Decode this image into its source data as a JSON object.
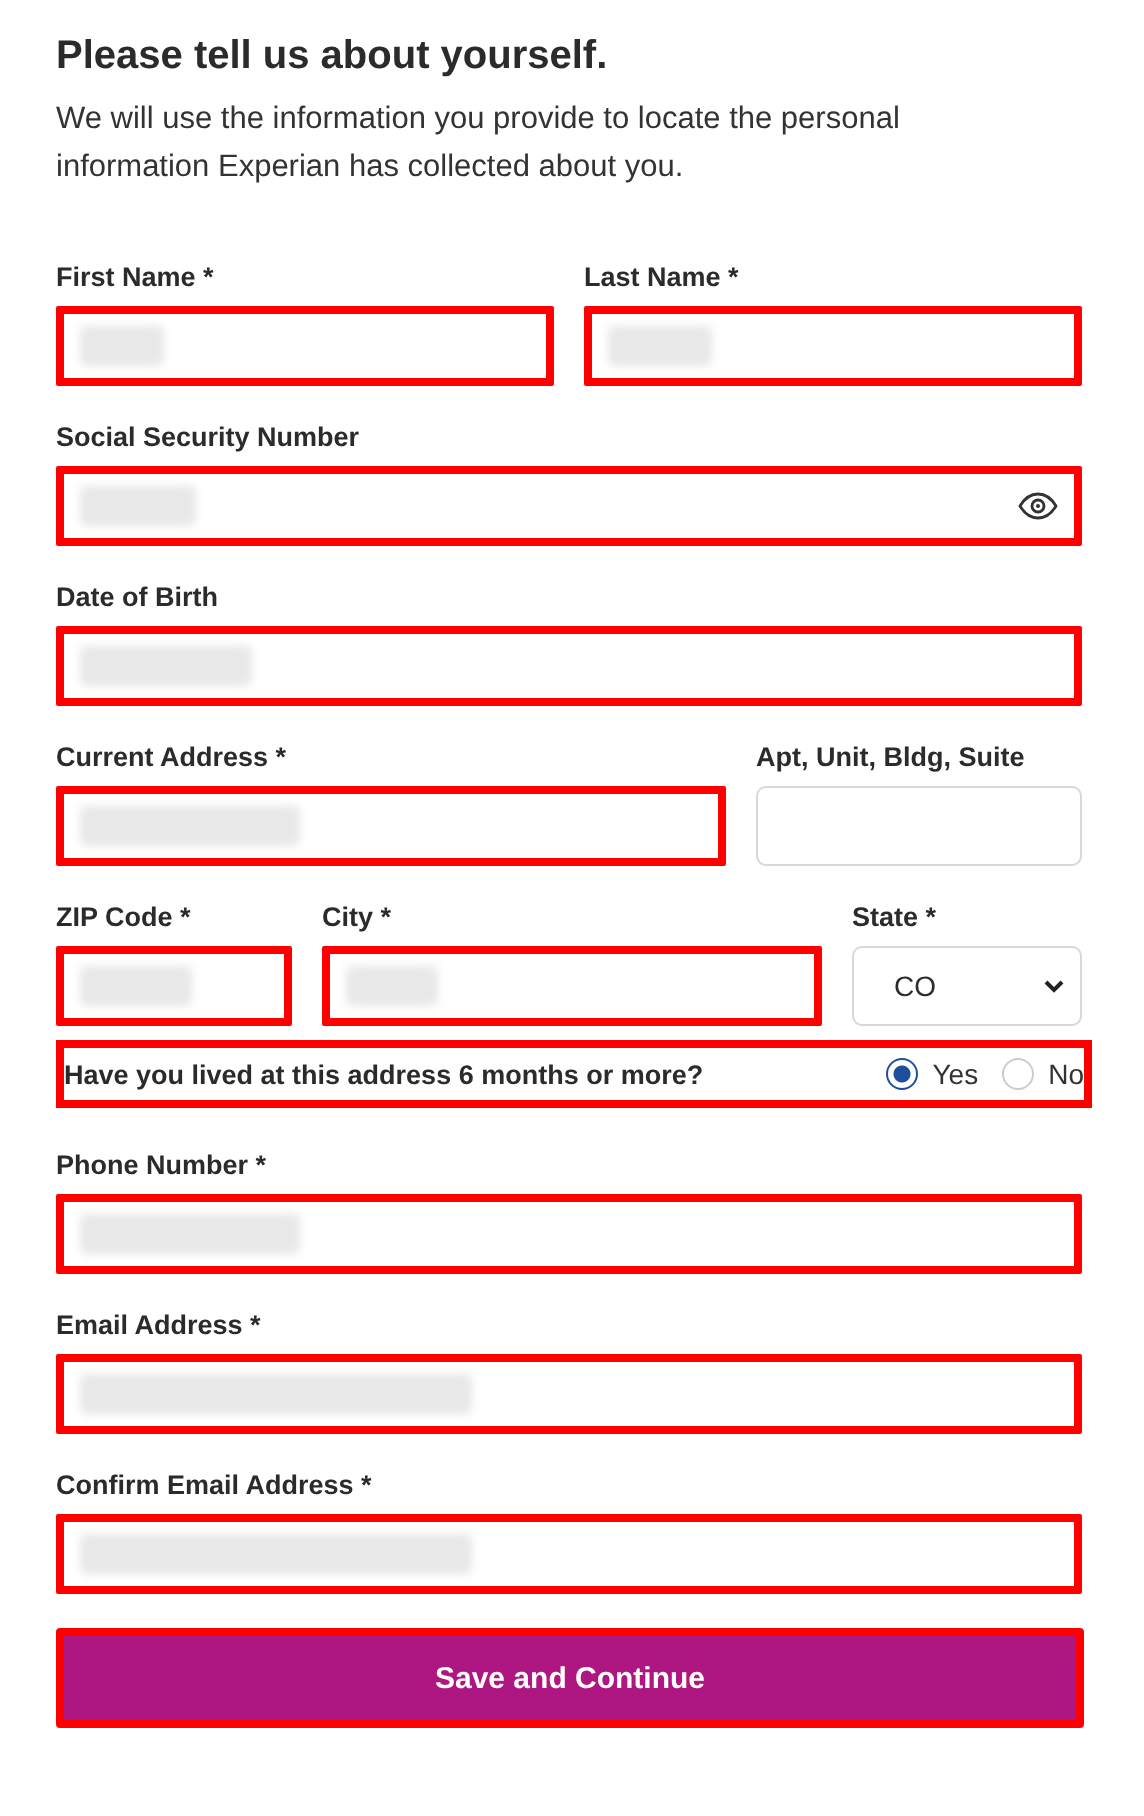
{
  "heading": "Please tell us about yourself.",
  "intro": "We will use the information you provide to locate the personal information Experian has collected about you.",
  "rows": [
    {
      "kind": "fields",
      "fields": [
        {
          "label": "First Name *",
          "kind": "text",
          "blurred": true,
          "highlighted": true
        },
        {
          "label": "Last Name *",
          "kind": "text",
          "blurred": true,
          "highlighted": true
        }
      ]
    },
    {
      "kind": "fields",
      "fields": [
        {
          "label": "Social Security Number",
          "kind": "password",
          "blurred": true,
          "highlighted": true
        }
      ]
    },
    {
      "kind": "fields",
      "fields": [
        {
          "label": "Date of Birth",
          "kind": "text",
          "blurred": true,
          "highlighted": true
        }
      ]
    },
    {
      "kind": "fields",
      "fields": [
        {
          "label": "Current Address *",
          "kind": "text",
          "blurred": true,
          "highlighted": true
        },
        {
          "label": "Apt, Unit, Bldg, Suite",
          "kind": "text",
          "blurred": false,
          "highlighted": false
        }
      ]
    },
    {
      "kind": "fields",
      "fields": [
        {
          "label": "ZIP Code *",
          "kind": "text",
          "blurred": true,
          "highlighted": true
        },
        {
          "label": "City *",
          "kind": "text",
          "blurred": true,
          "highlighted": true
        },
        {
          "label": "State *",
          "kind": "select",
          "value": "CO",
          "highlighted": false
        }
      ]
    },
    {
      "kind": "question",
      "text": "Have you lived at this address 6 months or more?",
      "highlighted": true,
      "options": [
        {
          "label": "Yes",
          "selected": true
        },
        {
          "label": "No",
          "selected": false
        }
      ]
    },
    {
      "kind": "fields",
      "fields": [
        {
          "label": "Phone Number *",
          "kind": "text",
          "blurred": true,
          "highlighted": true
        }
      ]
    },
    {
      "kind": "fields",
      "fields": [
        {
          "label": "Email Address *",
          "kind": "text",
          "blurred": true,
          "highlighted": true
        }
      ]
    },
    {
      "kind": "fields",
      "fields": [
        {
          "label": "Confirm Email Address *",
          "kind": "text",
          "blurred": true,
          "highlighted": true
        }
      ]
    }
  ],
  "button": {
    "label": "Save and Continue",
    "highlighted": true
  }
}
